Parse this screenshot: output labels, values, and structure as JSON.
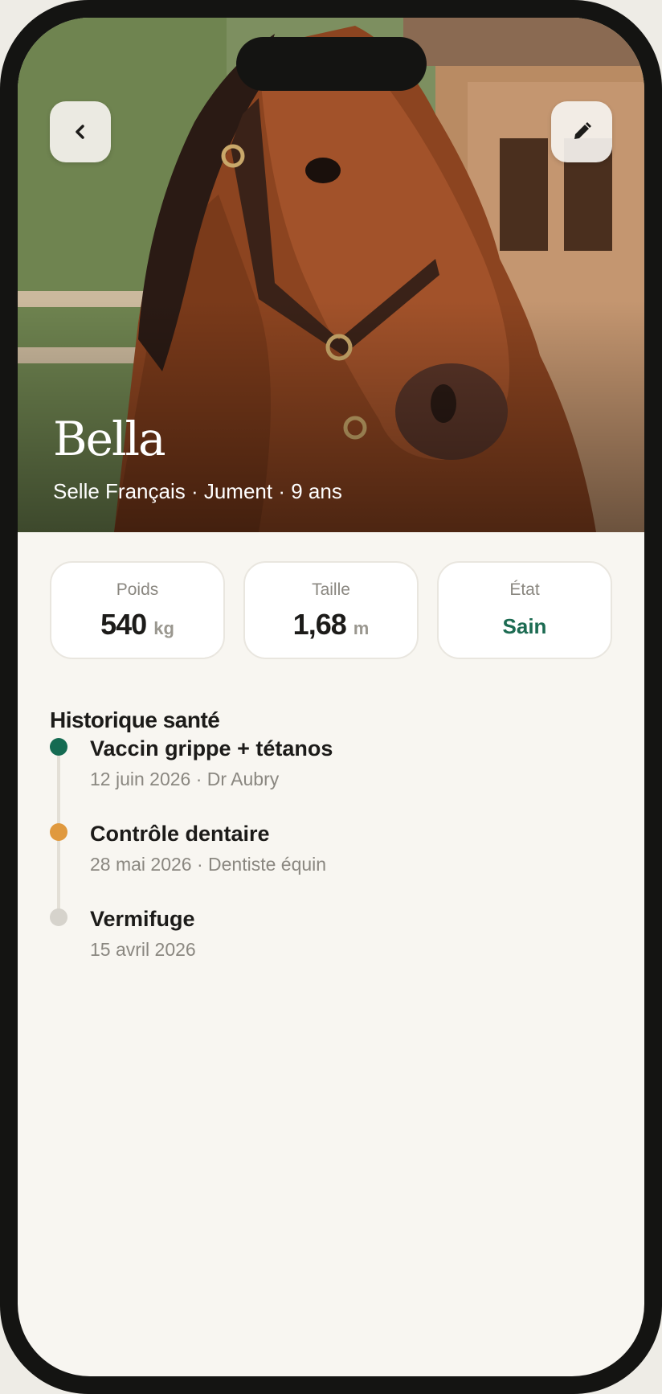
{
  "header": {
    "back_icon": "chevron-left-icon",
    "edit_icon": "pencil-icon"
  },
  "horse": {
    "name": "Bella",
    "breed": "Selle Français",
    "sex": "Jument",
    "age": "9 ans",
    "meta_separator": " · "
  },
  "stats": [
    {
      "label": "Poids",
      "value": "540",
      "unit": "kg"
    },
    {
      "label": "Taille",
      "value": "1,68",
      "unit": "m"
    },
    {
      "label": "État",
      "value": "Sain",
      "status_color": "#1c6b52"
    }
  ],
  "history": {
    "title": "Historique santé",
    "items": [
      {
        "title": "Vaccin grippe + tétanos",
        "subtitle": "12 juin 2026 · Dr Aubry",
        "dot_color": "#156b52"
      },
      {
        "title": "Contrôle dentaire",
        "subtitle": "28 mai 2026 · Dentiste équin",
        "dot_color": "#e0993e"
      },
      {
        "title": "Vermifuge",
        "subtitle": "15 avril 2026",
        "dot_color": "#d6d3cc"
      }
    ]
  },
  "colors": {
    "accent_green": "#1c6b52",
    "background": "#f8f6f1"
  }
}
